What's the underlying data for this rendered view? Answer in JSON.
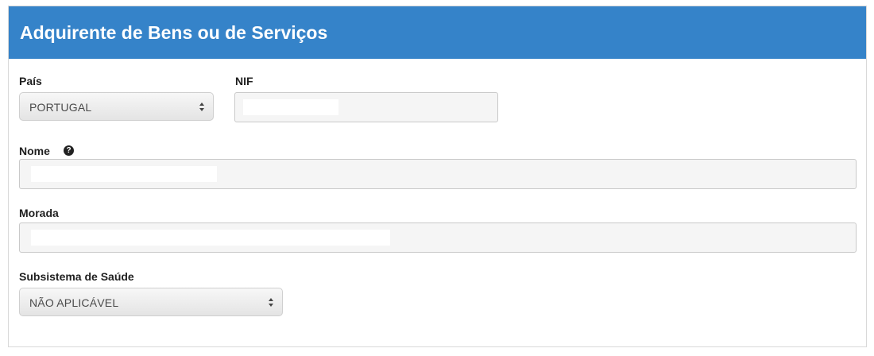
{
  "panel": {
    "title": "Adquirente de Bens ou de Serviços"
  },
  "form": {
    "pais": {
      "label": "País",
      "selected": "PORTUGAL"
    },
    "nif": {
      "label": "NIF",
      "value": ""
    },
    "nome": {
      "label": "Nome",
      "help_icon": "question-circle-icon",
      "value": ""
    },
    "morada": {
      "label": "Morada",
      "value": ""
    },
    "subsistema": {
      "label": "Subsistema de Saúde",
      "selected": "NÃO APLICÁVEL"
    }
  },
  "colors": {
    "header": "#3583c9",
    "header_text": "#ffffff"
  }
}
